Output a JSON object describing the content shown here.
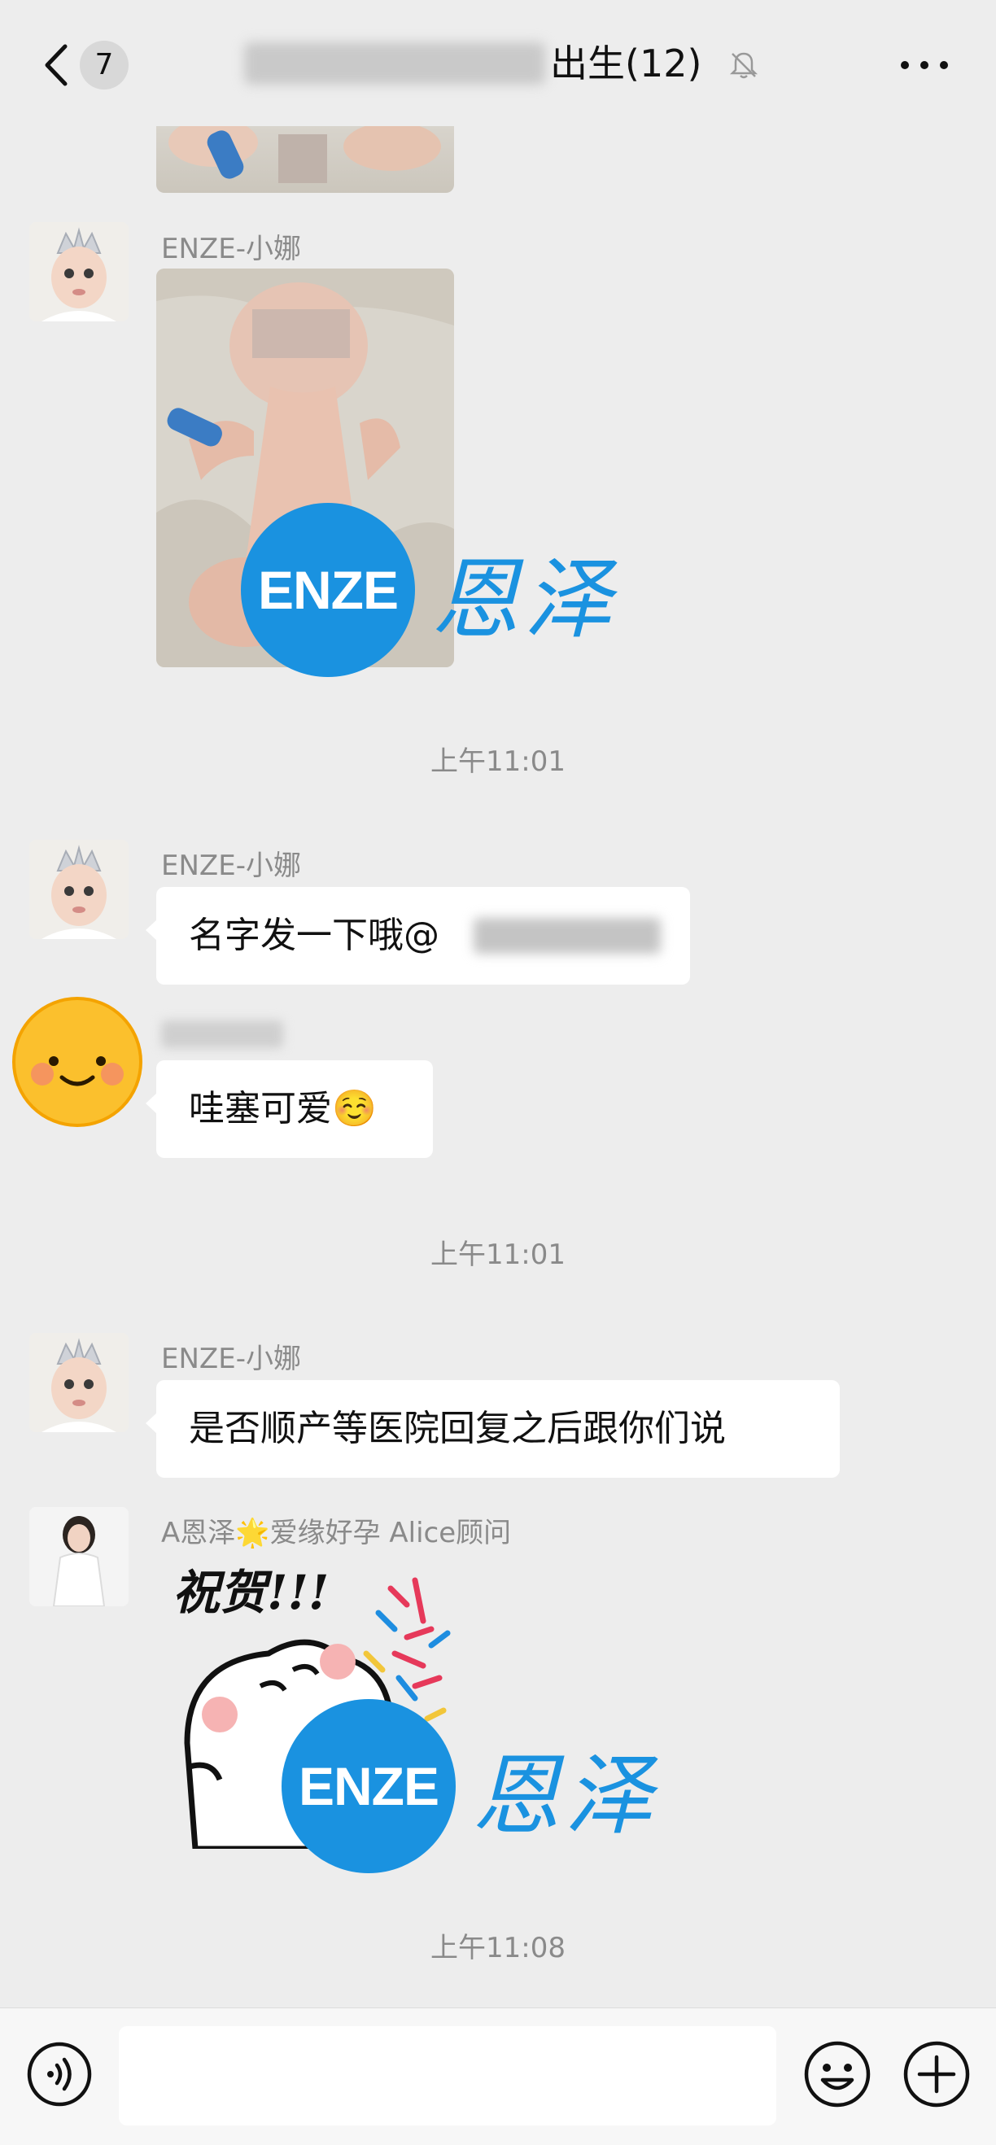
{
  "header": {
    "unread_count": "7",
    "title": "出生(12)",
    "back_icon": "chevron-left-icon",
    "mute_icon": "bell-off-icon",
    "more_icon": "more-dots-icon"
  },
  "messages": [
    {
      "sender": "ENZE-小娜",
      "type": "image"
    },
    {
      "time": "上午11:01"
    },
    {
      "sender": "ENZE-小娜",
      "text": "名字发一下哦@"
    },
    {
      "text": "哇塞可爱☺️"
    },
    {
      "time": "上午11:01"
    },
    {
      "sender": "ENZE-小娜",
      "text": "是否顺产等医院回复之后跟你们说"
    },
    {
      "sender": "A恩泽🌟爱缘好孕 Alice顾问",
      "type": "sticker",
      "sticker_text": "祝贺!!!"
    },
    {
      "time": "上午11:08"
    }
  ],
  "watermark": {
    "logo_text": "ENZE",
    "logo_cn": "恩泽"
  },
  "input_bar": {
    "voice_icon": "voice-icon",
    "emoji_icon": "emoji-icon",
    "plus_icon": "plus-icon"
  },
  "colors": {
    "background": "#ededed",
    "bubble": "#ffffff",
    "accent": "#1a92e0"
  }
}
